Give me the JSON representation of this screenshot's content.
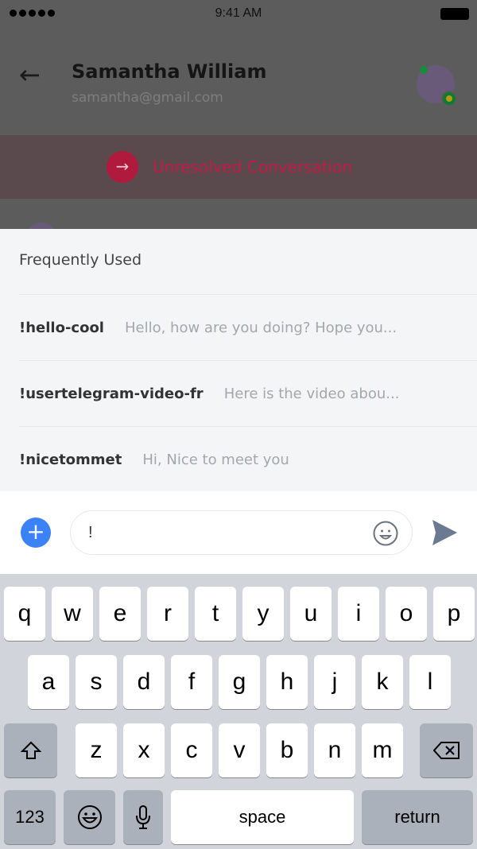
{
  "status": {
    "time": "9:41 AM"
  },
  "header": {
    "name": "Samantha William",
    "email": "samantha@gmail.com"
  },
  "banner": {
    "label": "Unresolved Conversation"
  },
  "suggestions": {
    "title": "Frequently Used",
    "items": [
      {
        "command": "!hello-cool",
        "text": "Hello, how are you doing? Hope you..."
      },
      {
        "command": "!usertelegram-video-fr",
        "text": "Here is the video abou..."
      },
      {
        "command": "!nicetommet",
        "text": "Hi, Nice to meet you"
      }
    ]
  },
  "composer": {
    "value": "!"
  },
  "keyboard": {
    "row1": [
      "q",
      "w",
      "e",
      "r",
      "t",
      "y",
      "u",
      "i",
      "o",
      "p"
    ],
    "row2": [
      "a",
      "s",
      "d",
      "f",
      "g",
      "h",
      "j",
      "k",
      "l"
    ],
    "row3": [
      "z",
      "x",
      "c",
      "v",
      "b",
      "n",
      "m"
    ],
    "numbers": "123",
    "space": "space",
    "return": "return"
  },
  "colors": {
    "accent": "#3b82f6",
    "unresolved": "#e11d48"
  }
}
